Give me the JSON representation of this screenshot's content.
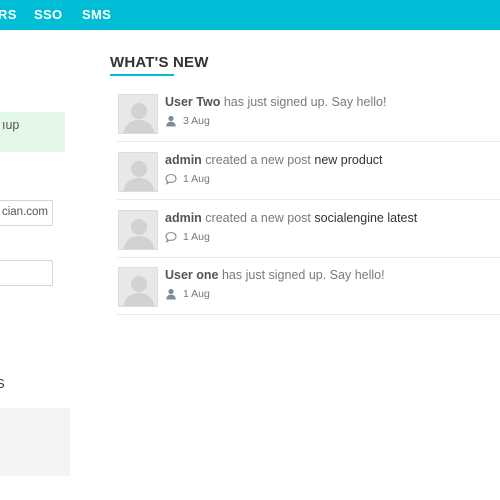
{
  "nav": {
    "items": [
      "RS",
      "SSO",
      "SMS"
    ]
  },
  "sidebar": {
    "notice_text": "ıup",
    "email_value": "cian.com",
    "second_value": "",
    "heading": "S"
  },
  "main": {
    "title": "WHAT'S NEW",
    "accent_color": "#00bcd4",
    "feed": [
      {
        "actor": "User Two",
        "action": " has just signed up. Say hello!",
        "target": "",
        "date": "3 Aug",
        "icon": "user-icon"
      },
      {
        "actor": "admin",
        "action": " created a new post ",
        "target": "new product",
        "date": "1 Aug",
        "icon": "comment-icon"
      },
      {
        "actor": "admin",
        "action": " created a new post ",
        "target": "socialengine latest",
        "date": "1 Aug",
        "icon": "comment-icon"
      },
      {
        "actor": "User one",
        "action": " has just signed up. Say hello!",
        "target": "",
        "date": "1 Aug",
        "icon": "user-icon"
      }
    ]
  }
}
